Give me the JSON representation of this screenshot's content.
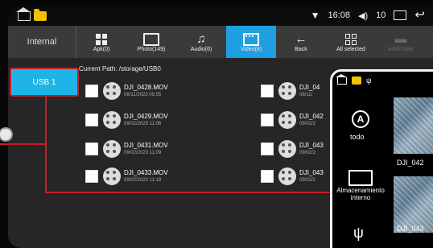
{
  "statusbar": {
    "time": "16:08",
    "volume_level": "10"
  },
  "toolbar": {
    "storage_label": "Internal",
    "buttons": [
      {
        "label": "Apk(0)",
        "icon": "apk-grid-icon"
      },
      {
        "label": "Photo(149)",
        "icon": "photo-icon"
      },
      {
        "label": "Audio(6)",
        "icon": "music-note-icon"
      },
      {
        "label": "Video(8)",
        "icon": "video-icon",
        "active": true
      },
      {
        "label": "Back",
        "icon": "back-arrow-icon"
      },
      {
        "label": "All selected",
        "icon": "select-all-icon"
      },
      {
        "label": "AddFolder",
        "icon": "add-folder-icon",
        "disabled": true
      }
    ]
  },
  "sidebar": {
    "usb_label": "USB 1"
  },
  "content": {
    "current_path": "Current Path: /storage/USB0",
    "files_left": [
      {
        "name": "DJI_0428.MOV",
        "date": "06/11/2023 09:55"
      },
      {
        "name": "DJI_0429.MOV",
        "date": "09/02/2020 11:06"
      },
      {
        "name": "DJI_0431.MOV",
        "date": "09/02/2020 11:09"
      },
      {
        "name": "DJI_0433.MOV",
        "date": "09/02/2020 11:18"
      }
    ],
    "files_right": [
      {
        "name": "DJI_04",
        "date": "06/11/"
      },
      {
        "name": "DJI_042",
        "date": "09/02/2"
      },
      {
        "name": "DJI_043",
        "date": "09/02/2"
      },
      {
        "name": "DJI_043",
        "date": "09/02/2"
      }
    ]
  },
  "phone": {
    "todo_label": "todo",
    "storage_label": "Almacenamiento interno",
    "photo_label_1": "DJI_042",
    "photo_label_2": "DJI_043"
  },
  "colors": {
    "accent": "#1f9fe0",
    "usb_button": "#1fb4e6",
    "callout_red": "#c41f2a",
    "folder_yellow": "#f2c200"
  }
}
